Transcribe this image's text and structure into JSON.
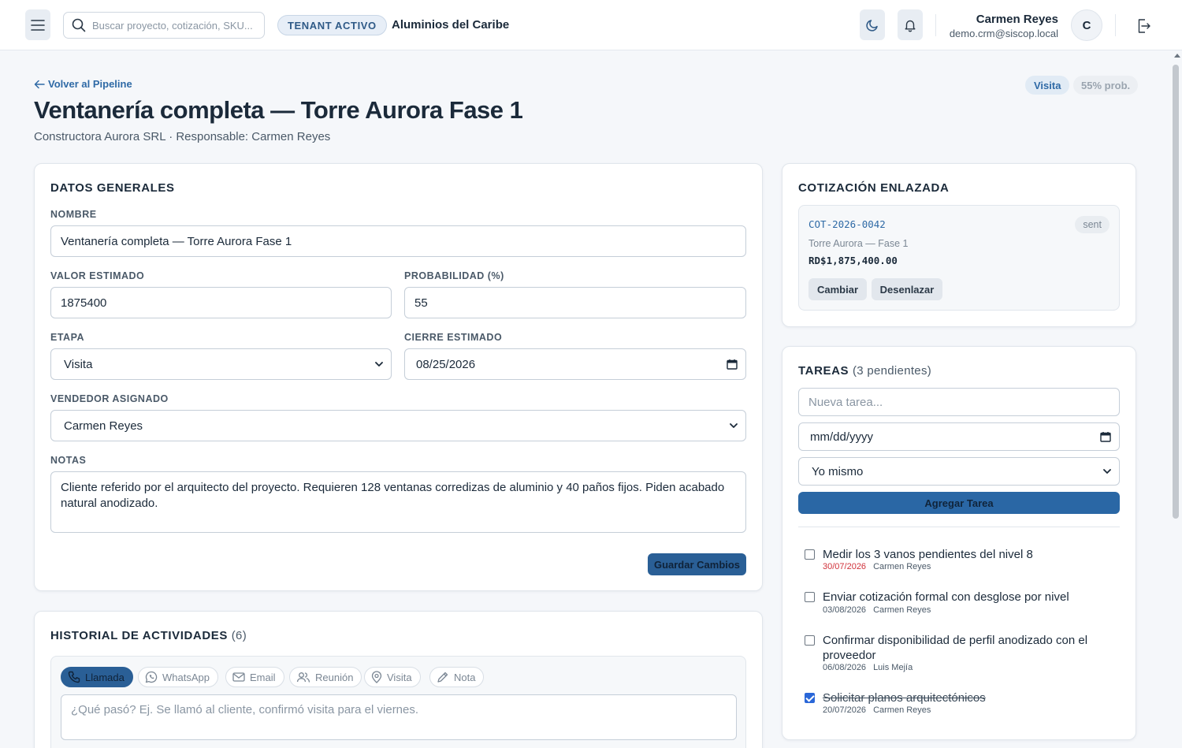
{
  "topbar": {
    "search_placeholder": "Buscar proyecto, cotización, SKU...",
    "tenant_badge": "TENANT ACTIVO",
    "tenant_name": "Aluminios del Caribe",
    "user_name": "Carmen Reyes",
    "user_email": "demo.crm@siscop.local",
    "avatar_initial": "C"
  },
  "header": {
    "back_label": "Volver al Pipeline",
    "stage_badge": "Visita",
    "prob_badge": "55% prob.",
    "title": "Ventanería completa — Torre Aurora Fase 1",
    "subtitle": "Constructora Aurora SRL · Responsable: Carmen Reyes"
  },
  "general": {
    "title": "DATOS GENERALES",
    "name_label": "NOMBRE",
    "name_value": "Ventanería completa — Torre Aurora Fase 1",
    "value_label": "VALOR ESTIMADO",
    "value_value": "1875400",
    "prob_label": "PROBABILIDAD (%)",
    "prob_value": "55",
    "stage_label": "ETAPA",
    "stage_value": "Visita",
    "close_label": "CIERRE ESTIMADO",
    "close_value": "08/25/2026",
    "seller_label": "VENDEDOR ASIGNADO",
    "seller_value": "Carmen Reyes",
    "notes_label": "NOTAS",
    "notes_value": "Cliente referido por el arquitecto del proyecto. Requieren 128 ventanas corredizas de aluminio y 40 paños fijos. Piden acabado natural anodizado.",
    "save_label": "Guardar Cambios"
  },
  "quote": {
    "title": "COTIZACIÓN ENLAZADA",
    "code": "COT-2026-0042",
    "status": "sent",
    "project": "Torre Aurora — Fase 1",
    "amount": "RD$1,875,400.00",
    "change_label": "Cambiar",
    "unlink_label": "Desenlazar"
  },
  "tasks": {
    "title": "TAREAS",
    "count": "(3 pendientes)",
    "new_placeholder": "Nueva tarea...",
    "date_placeholder": "mm/dd/yyyy",
    "assignee_value": "Yo mismo",
    "add_label": "Agregar Tarea",
    "items": [
      {
        "text": "Medir los 3 vanos pendientes del nivel 8",
        "due": "30/07/2026",
        "owner": "Carmen Reyes",
        "done": false,
        "overdue": true
      },
      {
        "text": "Enviar cotización formal con desglose por nivel",
        "due": "03/08/2026",
        "owner": "Carmen Reyes",
        "done": false,
        "overdue": false
      },
      {
        "text": "Confirmar disponibilidad de perfil anodizado con el proveedor",
        "due": "06/08/2026",
        "owner": "Luis Mejía",
        "done": false,
        "overdue": false
      },
      {
        "text": "Solicitar planos arquitectónicos",
        "due": "20/07/2026",
        "owner": "Carmen Reyes",
        "done": true,
        "overdue": false
      }
    ]
  },
  "activity": {
    "title": "HISTORIAL DE ACTIVIDADES",
    "count": "(6)",
    "chips": [
      "Llamada",
      "WhatsApp",
      "Email",
      "Reunión",
      "Visita",
      "Nota"
    ],
    "active_chip": "Llamada",
    "input_placeholder": "¿Qué pasó? Ej. Se llamó al cliente, confirmó visita para el viernes."
  },
  "colors": {
    "accent": "#2a67a5",
    "overdue": "#d0313a",
    "background": "#f5f7fa"
  }
}
